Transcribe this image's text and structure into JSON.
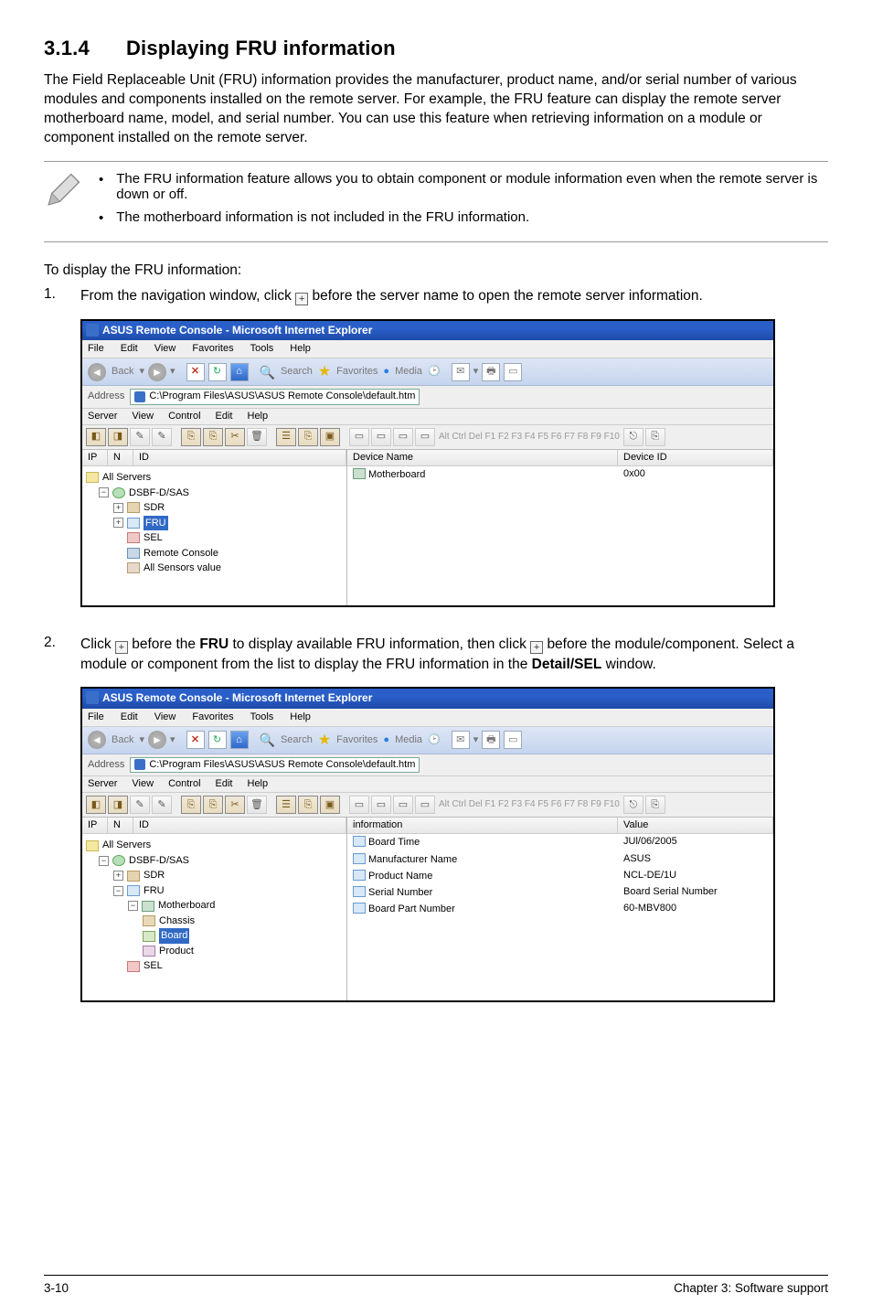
{
  "heading": {
    "number": "3.1.4",
    "title": "Displaying FRU information"
  },
  "intro": "The Field Replaceable Unit (FRU) information provides the manufacturer, product name, and/or serial number of various modules and components installed on the remote server. For example, the FRU feature can display the remote server motherboard name, model, and serial number. You can use this feature when retrieving information on a module or component installed on the remote server.",
  "notes": [
    "The FRU information feature allows you to obtain component or module information even when the remote server is down or off.",
    "The motherboard information is not included in the FRU information."
  ],
  "instruction_lead": "To display the FRU information:",
  "steps": {
    "1": {
      "num": "1.",
      "text_before": "From the navigation window, click ",
      "text_after": " before the server name to open the remote server information."
    },
    "2": {
      "num": "2.",
      "part1_before": "Click ",
      "part1_mid": " before the ",
      "fru_label": "FRU",
      "part1_after": " to display available FRU information, then click ",
      "line2": "before the module/component. Select a module or component from the list to display the FRU information in the ",
      "detail_label": "Detail/SEL",
      "line2_end": " window."
    }
  },
  "window_title": "ASUS Remote Console - Microsoft Internet Explorer",
  "ie_menu": [
    "File",
    "Edit",
    "View",
    "Favorites",
    "Tools",
    "Help"
  ],
  "ie_toolbar": {
    "back": "Back",
    "search": "Search",
    "favorites": "Favorites",
    "media": "Media"
  },
  "ie_addr": {
    "label": "Address",
    "path": "C:\\Program Files\\ASUS\\ASUS Remote Console\\default.htm"
  },
  "app_menu": [
    "Server",
    "View",
    "Control",
    "Edit",
    "Help"
  ],
  "fkeys_line": "Alt Ctrl Del  F1  F2  F3  F4  F5  F6  F7  F8  F9 F10",
  "tree_columns": {
    "ip": "IP",
    "n": "N",
    "id": "ID"
  },
  "screenshot1": {
    "tree": {
      "root": "All Servers",
      "server": "DSBF-D/SAS",
      "sdr": "SDR",
      "fru": "FRU",
      "sel": "SEL",
      "remote": "Remote Console",
      "sensors": "All Sensors value"
    },
    "grid": {
      "col1": "Device Name",
      "col2": "Device ID",
      "row1_name": "Motherboard",
      "row1_id": "0x00"
    }
  },
  "screenshot2": {
    "tree": {
      "root": "All Servers",
      "server": "DSBF-D/SAS",
      "sdr": "SDR",
      "fru": "FRU",
      "motherboard": "Motherboard",
      "chassis": "Chassis",
      "board": "Board",
      "product": "Product",
      "sel": "SEL"
    },
    "grid": {
      "col1": "information",
      "col2": "Value",
      "rows": [
        {
          "name": "Board Time",
          "value": "JUl/06/2005"
        },
        {
          "name": "Manufacturer Name",
          "value": "ASUS"
        },
        {
          "name": "Product Name",
          "value": "NCL-DE/1U"
        },
        {
          "name": "Serial Number",
          "value": "Board Serial Number"
        },
        {
          "name": "Board Part Number",
          "value": "60-MBV800"
        }
      ]
    }
  },
  "footer": {
    "left": "3-10",
    "right": "Chapter 3: Software support"
  }
}
